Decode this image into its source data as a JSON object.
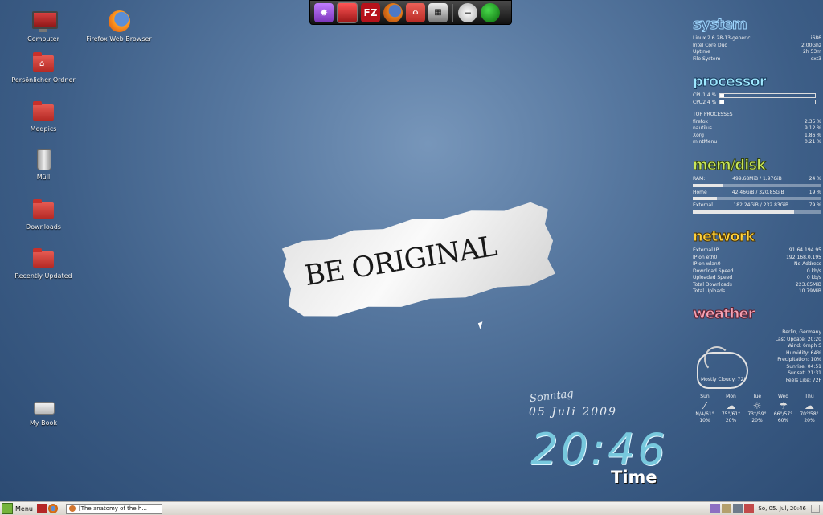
{
  "desktop": {
    "icons": [
      {
        "label": "Computer",
        "icon": "computer-icon"
      },
      {
        "label": "Firefox Web Browser",
        "icon": "firefox-icon"
      },
      {
        "label": "Persönlicher Ordner",
        "icon": "home-folder-icon"
      },
      {
        "label": "Medpics",
        "icon": "folder-icon"
      },
      {
        "label": "Müll",
        "icon": "trash-icon"
      },
      {
        "label": "Downloads",
        "icon": "folder-icon"
      },
      {
        "label": "Recently Updated",
        "icon": "folder-icon"
      },
      {
        "label": "My Book",
        "icon": "drive-icon"
      }
    ]
  },
  "dock": {
    "items": [
      {
        "icon": "settings-icon"
      },
      {
        "icon": "computer-icon"
      },
      {
        "icon": "filezilla-icon",
        "text": "FZ"
      },
      {
        "icon": "firefox-icon"
      },
      {
        "icon": "home-folder-icon"
      },
      {
        "icon": "video-icon"
      },
      {
        "icon": "minimize-icon"
      },
      {
        "icon": "power-icon"
      }
    ]
  },
  "wallpaper": {
    "text": "BE ORIGINAL"
  },
  "clock": {
    "weekday": "Sonntag",
    "date": "05 Juli 2009",
    "time": "20:46",
    "word": "Time"
  },
  "conky": {
    "system": {
      "title": "system",
      "rows": [
        {
          "k": "Linux 2.6.28-13-generic",
          "v": "i686"
        },
        {
          "k": "Intel Core Duo",
          "v": "2.00Ghz"
        },
        {
          "k": "Uptime",
          "v": "2h 53m"
        },
        {
          "k": "File System",
          "v": "ext3"
        }
      ]
    },
    "processor": {
      "title": "processor",
      "cpu1": "CPU1   4  %",
      "cpu2": "CPU2   4  %",
      "cpu1_pct": 4,
      "cpu2_pct": 4,
      "top_title": "TOP PROCESSES",
      "processes": [
        {
          "name": "firefox",
          "pct": "2.35 %"
        },
        {
          "name": "nautilus",
          "pct": "9.12 %"
        },
        {
          "name": "Xorg",
          "pct": "1.86 %"
        },
        {
          "name": "mintMenu",
          "pct": "0.21 %"
        }
      ]
    },
    "memdisk": {
      "title": "mem/disk",
      "rows": [
        {
          "label": "RAM:",
          "detail": "499.68MiB / 1.97GiB",
          "pct": "24 %",
          "fill": 0.24
        },
        {
          "label": "Home",
          "detail": "42.46GiB / 320.85GiB",
          "pct": "19 %",
          "fill": 0.19
        },
        {
          "label": "External",
          "detail": "182.24GiB / 232.83GiB",
          "pct": "79 %",
          "fill": 0.79
        }
      ]
    },
    "network": {
      "title": "network",
      "rows": [
        {
          "k": "External IP",
          "v": "91.64.194.95"
        },
        {
          "k": "IP on eth0",
          "v": "192.168.0.195"
        },
        {
          "k": "IP on wlan0",
          "v": "No Address"
        },
        {
          "k": "Download Speed",
          "v": "0     kb/s"
        },
        {
          "k": "Uploaded Speed",
          "v": "0     kb/s"
        },
        {
          "k": "Total Downloads",
          "v": "223.65MiB"
        },
        {
          "k": "Total Uploads",
          "v": "10.79MiB"
        }
      ]
    },
    "weather": {
      "title": "weather",
      "city": "Berlin, Germany",
      "lines": [
        "Last Update: 20:20",
        "Wind: 6mph S",
        "Humidity: 64%",
        "Precipitation: 10%",
        "Sunrise: 04:51",
        "Sunset: 21:31",
        "Feels Like: 72F"
      ],
      "summary": "Mostly Cloudy: 72°",
      "forecast": [
        {
          "day": "Sun",
          "icon": "N/A",
          "temp": "N/A/61°",
          "precip": "10%"
        },
        {
          "day": "Mon",
          "icon": "cloud-icon",
          "temp": "75°/61°",
          "precip": "20%"
        },
        {
          "day": "Tue",
          "icon": "sun-icon",
          "temp": "73°/59°",
          "precip": "20%"
        },
        {
          "day": "Wed",
          "icon": "rain-icon",
          "temp": "66°/57°",
          "precip": "60%"
        },
        {
          "day": "Thu",
          "icon": "cloud-icon",
          "temp": "70°/58°",
          "precip": "20%"
        }
      ]
    }
  },
  "panel": {
    "menu": "Menu",
    "task": "[The anatomy of the h...",
    "datetime": "So, 05. Jul, 20:46"
  }
}
